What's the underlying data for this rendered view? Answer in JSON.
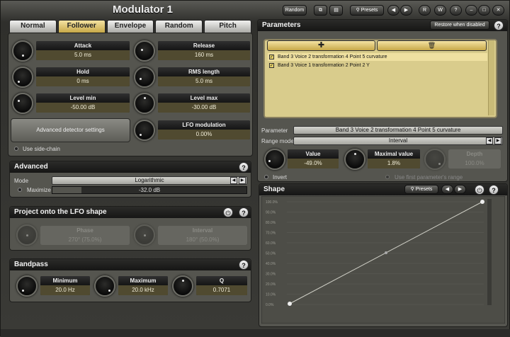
{
  "title": "Modulator 1",
  "topbar": {
    "random": "Random",
    "presets": "Presets",
    "r": "R",
    "w": "W",
    "help": "?"
  },
  "tabs": [
    "Normal",
    "Follower",
    "Envelope",
    "Random",
    "Pitch"
  ],
  "follower": {
    "attack": {
      "name": "Attack",
      "value": "5.0 ms"
    },
    "release": {
      "name": "Release",
      "value": "160 ms"
    },
    "hold": {
      "name": "Hold",
      "value": "0 ms"
    },
    "rms": {
      "name": "RMS length",
      "value": "5.0 ms"
    },
    "levelmin": {
      "name": "Level min",
      "value": "-50.00 dB"
    },
    "levelmax": {
      "name": "Level max",
      "value": "-30.00 dB"
    },
    "lfo": {
      "name": "LFO modulation",
      "value": "0.00%"
    },
    "adv_btn": "Advanced detector settings",
    "sidechain": "Use side-chain"
  },
  "advanced": {
    "title": "Advanced",
    "mode_label": "Mode",
    "mode_value": "Logarithmic",
    "maximize": "Maximize",
    "max_value": "-32.0 dB",
    "max_fill": 0.15
  },
  "project": {
    "title": "Project onto the LFO shape",
    "phase": {
      "name": "Phase",
      "value": "270° (75.0%)"
    },
    "interval": {
      "name": "Interval",
      "value": "180° (50.0%)"
    }
  },
  "bandpass": {
    "title": "Bandpass",
    "min": {
      "name": "Minimum",
      "value": "20.0 Hz"
    },
    "max": {
      "name": "Maximum",
      "value": "20.0 kHz"
    },
    "q": {
      "name": "Q",
      "value": "0.7071"
    }
  },
  "parameters": {
    "title": "Parameters",
    "restore": "Restore when disabled",
    "items": [
      "Band 3 Voice 2 transformation 4 Point 5 curvature",
      "Band 3 Voice 1 transformation 2 Point 2 Y"
    ],
    "param_label": "Parameter",
    "param_value": "Band 3 Voice 2 transformation 4 Point 5 curvature",
    "range_label": "Range mode",
    "range_value": "Interval",
    "value": {
      "name": "Value",
      "value": "-49.0%"
    },
    "maxval": {
      "name": "Maximal value",
      "value": "1.8%"
    },
    "depth": {
      "name": "Depth",
      "value": "100.0%"
    },
    "invert": "Invert",
    "firstrange": "Use first parameter's range"
  },
  "shape": {
    "title": "Shape",
    "presets": "Presets",
    "yticks": [
      "100.0%",
      "90.0%",
      "80.0%",
      "70.0%",
      "60.0%",
      "50.0%",
      "40.0%",
      "30.0%",
      "20.0%",
      "10.0%",
      "0.0%"
    ]
  },
  "colors": {
    "accent": "#e4c75c",
    "value_bg": "#504a30"
  }
}
